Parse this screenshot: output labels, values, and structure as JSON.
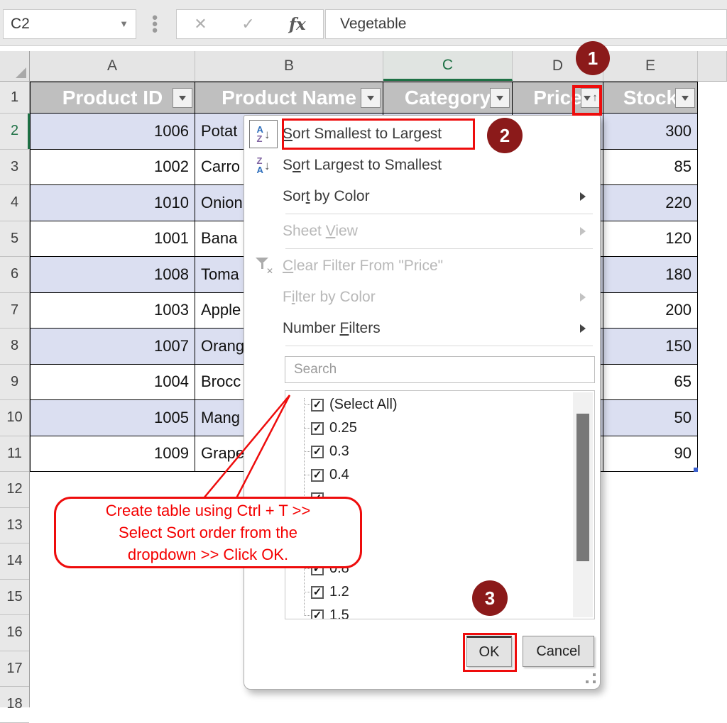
{
  "colors": {
    "annotation_red": "#ee0c0c",
    "badge_maroon": "#8b1a1a",
    "excel_green": "#1e7145",
    "band_fill": "#dbdff1",
    "table_header_bg": "#bfbfbf"
  },
  "formula_bar": {
    "name_box_value": "C2",
    "cancel_label": "✕",
    "enter_label": "✓",
    "fx_label": "fx",
    "formula_value": "Vegetable"
  },
  "sheet": {
    "column_letters": [
      "A",
      "B",
      "C",
      "D",
      "E"
    ],
    "selected_column": "C",
    "active_row": 2,
    "row_numbers": [
      1,
      2,
      3,
      4,
      5,
      6,
      7,
      8,
      9,
      10,
      11,
      12,
      13,
      14,
      15,
      16,
      17,
      18
    ]
  },
  "table": {
    "headers": [
      {
        "label": "Product ID"
      },
      {
        "label": "Product Name"
      },
      {
        "label": "Category"
      },
      {
        "label": "Price",
        "sort_indicator": true,
        "highlighted": true
      },
      {
        "label": "Stock"
      }
    ],
    "rows": [
      {
        "product_id": "1006",
        "product_name": "Potat",
        "stock": "300"
      },
      {
        "product_id": "1002",
        "product_name": "Carro",
        "stock": "85"
      },
      {
        "product_id": "1010",
        "product_name": "Onion",
        "stock": "220"
      },
      {
        "product_id": "1001",
        "product_name": "Bana",
        "stock": "120"
      },
      {
        "product_id": "1008",
        "product_name": "Toma",
        "stock": "180"
      },
      {
        "product_id": "1003",
        "product_name": "Apple",
        "stock": "200"
      },
      {
        "product_id": "1007",
        "product_name": "Orang",
        "stock": "150"
      },
      {
        "product_id": "1004",
        "product_name": "Brocc",
        "stock": "65"
      },
      {
        "product_id": "1005",
        "product_name": "Mang",
        "stock": "50"
      },
      {
        "product_id": "1009",
        "product_name": "Grape",
        "stock": "90"
      }
    ]
  },
  "filter_menu": {
    "items": [
      {
        "label": "Sort Smallest to Largest",
        "underline": 0,
        "icon": "sort-az-icon",
        "enabled": true,
        "highlighted": true
      },
      {
        "label": "Sort Largest to Smallest",
        "underline": 1,
        "icon": "sort-za-icon",
        "enabled": true
      },
      {
        "label": "Sort by Color",
        "underline": 3,
        "enabled": true,
        "submenu": true
      },
      {
        "divider": true
      },
      {
        "label": "Sheet View",
        "underline": 6,
        "enabled": false,
        "submenu": true
      },
      {
        "divider": true
      },
      {
        "label": "Clear Filter From \"Price\"",
        "underline": 0,
        "icon": "clear-filter-icon",
        "enabled": false
      },
      {
        "label": "Filter by Color",
        "underline": 1,
        "enabled": false,
        "submenu": true
      },
      {
        "label": "Number Filters",
        "underline": 7,
        "enabled": true,
        "submenu": true
      },
      {
        "divider": true
      }
    ],
    "search_placeholder": "Search",
    "checkbox_items": [
      {
        "label": "(Select All)",
        "checked": true
      },
      {
        "label": "0.25",
        "checked": true
      },
      {
        "label": "0.3",
        "checked": true
      },
      {
        "label": "0.4",
        "checked": true
      },
      {
        "label": "",
        "checked": true
      },
      {
        "label": "",
        "checked": true
      },
      {
        "label": "",
        "checked": true
      },
      {
        "label": "0.8",
        "checked": true
      },
      {
        "label": "1.2",
        "checked": true
      },
      {
        "label": "1.5",
        "checked": true
      }
    ],
    "ok_label": "OK",
    "cancel_label": "Cancel"
  },
  "annotations": {
    "badges": [
      {
        "label": "1"
      },
      {
        "label": "2"
      },
      {
        "label": "3"
      }
    ],
    "callout_lines": [
      "Create table using Ctrl + T >>",
      "Select Sort order from the",
      "dropdown >> Click OK."
    ]
  }
}
